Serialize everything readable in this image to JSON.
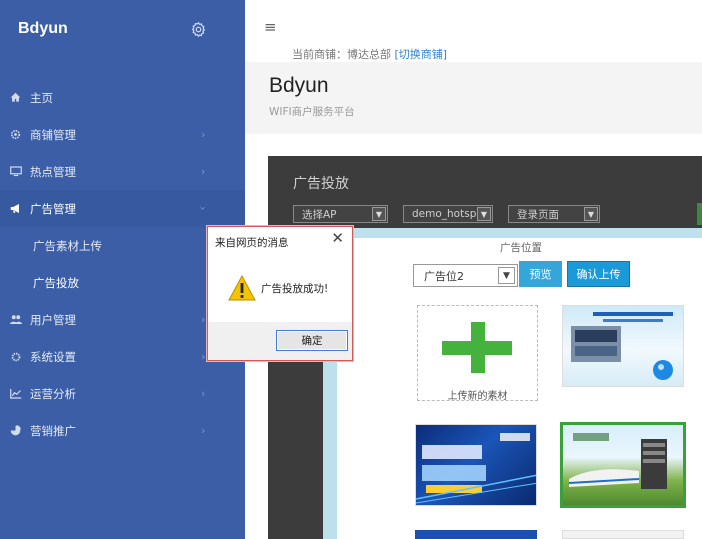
{
  "sidebar": {
    "brand": "Bdyun",
    "items": [
      {
        "label": "主页",
        "icon": "home-icon"
      },
      {
        "label": "商铺管理",
        "icon": "gear-icon",
        "chevron": "›"
      },
      {
        "label": "热点管理",
        "icon": "monitor-icon",
        "chevron": "›"
      },
      {
        "label": "广告管理",
        "icon": "megaphone-icon",
        "chevron": "›"
      },
      {
        "label": "用户管理",
        "icon": "users-icon",
        "chevron": "›"
      },
      {
        "label": "系统设置",
        "icon": "gear-icon",
        "chevron": "›"
      },
      {
        "label": "运营分析",
        "icon": "chart-icon",
        "chevron": "›"
      },
      {
        "label": "营销推广",
        "icon": "pie-icon",
        "chevron": "›"
      }
    ],
    "subitems": [
      {
        "label": "广告素材上传"
      },
      {
        "label": "广告投放"
      }
    ]
  },
  "topbar": {
    "shop_prefix": "当前商铺：博达总部",
    "shop_switch": "[切换商铺]"
  },
  "header": {
    "title": "Bdyun",
    "subtitle": "WIFI商户服务平台"
  },
  "frame": {
    "title": "广告投放",
    "filters": [
      "选择AP",
      "demo_hotspot",
      "登录页面"
    ]
  },
  "panel": {
    "position_label": "广告位置",
    "position_value": "广告位2",
    "preview_label": "预览",
    "upload_label": "确认上传",
    "upload_tile_label": "上传新的素材"
  },
  "dialog": {
    "title": "来自网页的消息",
    "message": "广告投放成功!",
    "ok_label": "确定"
  },
  "colors": {
    "sidebar_bg": "#3b5ea6",
    "accent_blue": "#1a9ad9",
    "success_green": "#44b23d",
    "warning_yellow": "#f5c400"
  }
}
